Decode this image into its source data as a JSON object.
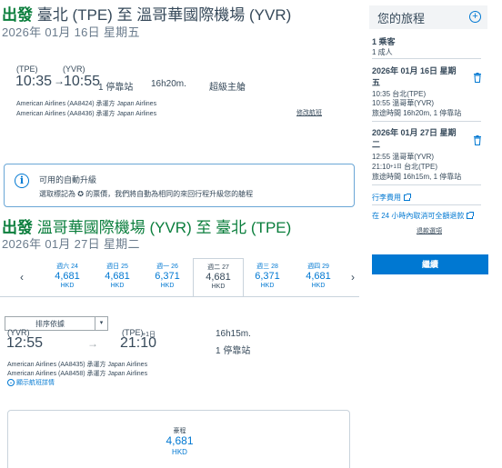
{
  "outbound": {
    "direction": "出發",
    "route": "臺北 (TPE) 至 溫哥華國際機場 (YVR)",
    "date": "2026年 01月 16日 星期五",
    "origin_code": "(TPE)",
    "dest_code": "(YVR)",
    "depart_time": "10:35",
    "arrow": "→",
    "arrive_time": "10:55",
    "stops": "1 停靠站",
    "duration": "16h20m.",
    "cabin": "超級主艙",
    "flight1": "American Airlines (AA8424) 承運方 Japan Airlines",
    "flight2": "American Airlines (AA8436) 承運方 Japan Airlines",
    "change_flight": "修改航班"
  },
  "upgrade": {
    "title": "可用的自動升級",
    "description": "選取標記為 ✪ 的票價，我們將自動為相同的來回行程升級您的艙程"
  },
  "inbound": {
    "direction": "出發",
    "route": "溫哥華國際機場 (YVR) 至 臺北 (TPE)",
    "date": "2026年 01月 27日 星期二",
    "origin_code": "(YVR)",
    "dest_code": "(TPE)",
    "day_offset": "+1日",
    "depart_time": "12:55",
    "arrow": "→",
    "arrive_time": "21:10",
    "duration": "16h15m.",
    "stops": "1 停靠站",
    "flight1": "American Airlines (AA8435) 承運方 Japan Airlines",
    "flight2": "American Airlines (AA8458) 承運方 Japan Airlines",
    "details_link": "顯示航班詳情"
  },
  "carousel": {
    "prev": "‹",
    "next": "›",
    "days": [
      {
        "label": "週六 24",
        "price": "4,681",
        "currency": "HKD"
      },
      {
        "label": "週日 25",
        "price": "4,681",
        "currency": "HKD"
      },
      {
        "label": "週一 26",
        "price": "6,371",
        "currency": "HKD"
      },
      {
        "label": "週二 27",
        "price": "4,681",
        "currency": "HKD"
      },
      {
        "label": "週三 28",
        "price": "6,371",
        "currency": "HKD"
      },
      {
        "label": "週四 29",
        "price": "4,681",
        "currency": "HKD"
      }
    ]
  },
  "sort": {
    "label": "排序依據",
    "caret": "▾"
  },
  "fare_card": {
    "label": "豪程",
    "price": "4,681",
    "currency": "HKD"
  },
  "sidebar": {
    "title": "您的旅程",
    "add_icon": "+",
    "passengers": "1 乘客",
    "passenger_type": "1 成人",
    "outbound_date": "2026年 01月 16日 星期五",
    "outbound_depart": "10:35 台北(TPE)",
    "outbound_arrive": "10:55 溫哥華(YVR)",
    "outbound_summary": "旅途時間 16h20m, 1 停靠站",
    "inbound_date": "2026年 01月 27日 星期二",
    "inbound_depart": "12:55 溫哥華(YVR)",
    "inbound_arrive_time": "21:10",
    "inbound_arrive_offset": "+1日",
    "inbound_arrive_city": "台北(TPE)",
    "inbound_summary": "旅途時間 16h15m, 1 停靠站",
    "baggage_link": "行李費用",
    "cancel_link": "在 24 小時內取消可全額退款",
    "details_link": "退款選項",
    "continue": "繼續"
  }
}
